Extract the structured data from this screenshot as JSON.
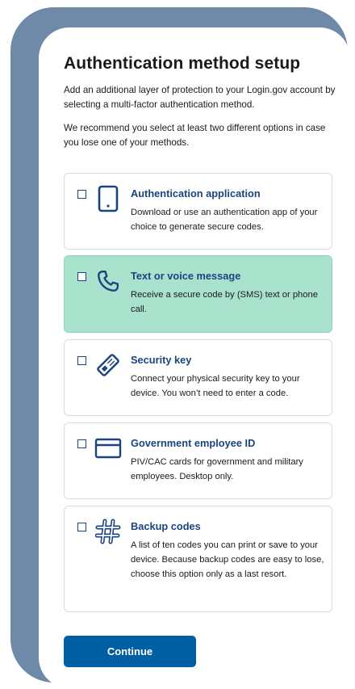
{
  "page": {
    "title": "Authentication method setup",
    "intro": "Add an additional layer of protection to your Login.gov account by selecting a multi-factor authentication method.",
    "recommendation": "We recommend you select at least two different options in case you lose one of your methods."
  },
  "options": [
    {
      "title": "Authentication application",
      "description": "Download or use an authentication app of your choice to generate secure codes.",
      "icon": "phone-app-icon",
      "selected": false
    },
    {
      "title": "Text or voice message",
      "description": "Receive a secure code by (SMS) text or phone call.",
      "icon": "phone-handset-icon",
      "selected": true
    },
    {
      "title": "Security key",
      "description": "Connect your physical security key to your device. You won’t need to enter a code.",
      "icon": "security-key-icon",
      "selected": false
    },
    {
      "title": "Government employee ID",
      "description": "PIV/CAC cards for government and military employees. Desktop only.",
      "icon": "id-card-icon",
      "selected": false
    },
    {
      "title": "Backup codes",
      "description": "A list of ten codes you can print or save to your device. Because backup codes are easy to lose, choose this option only as a last resort.",
      "icon": "hashtag-icon",
      "selected": false
    }
  ],
  "actions": {
    "continue_label": "Continue"
  },
  "colors": {
    "frame": "#6f89a8",
    "link_blue": "#1a4480",
    "button_blue": "#005ea2",
    "selected_bg": "#a8e2cc",
    "border": "#d6dce4"
  }
}
